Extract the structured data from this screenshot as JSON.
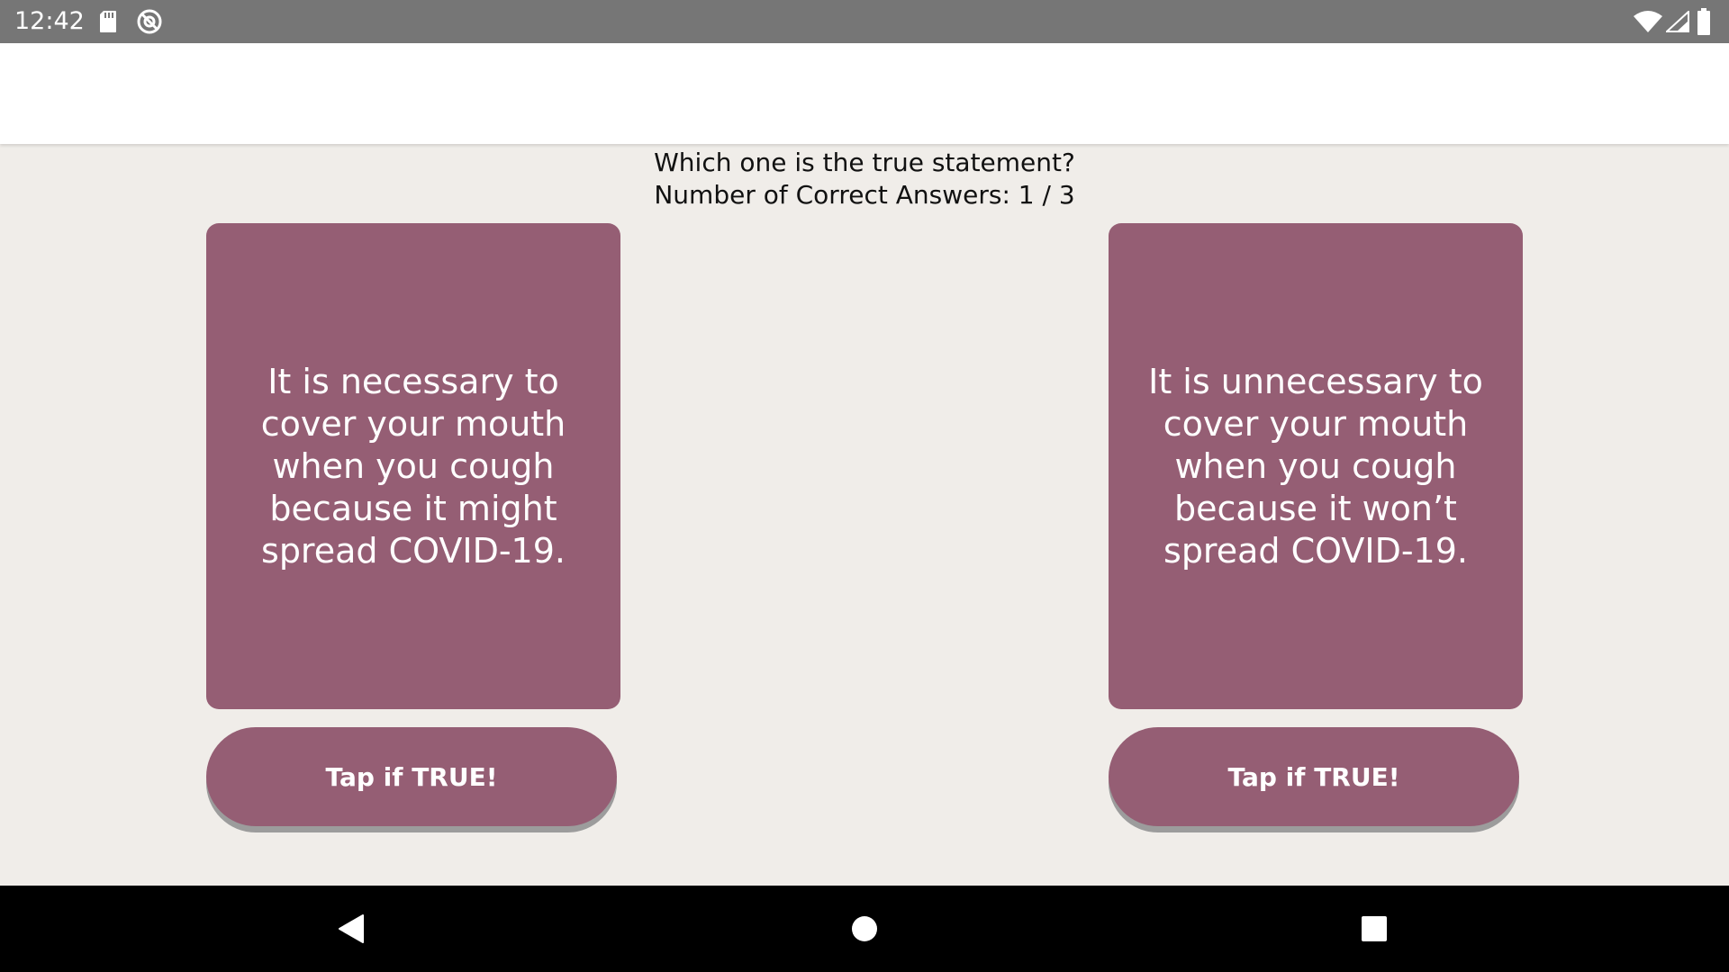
{
  "status_bar": {
    "time": "12:42",
    "icons": [
      "sd-card-icon",
      "sync-icon",
      "wifi-icon",
      "cell-signal-icon",
      "battery-icon"
    ]
  },
  "quiz": {
    "question": "Which one is the true statement?",
    "score_text": "Number of Correct Answers: 1 / 3",
    "options": [
      {
        "statement": "It is necessary to cover your mouth when you cough because it might spread COVID-19.",
        "button_label": "Tap if TRUE!"
      },
      {
        "statement": "It is unnecessary to cover your mouth when you cough because it won’t spread COVID-19.",
        "button_label": "Tap if TRUE!"
      }
    ]
  },
  "nav_bar": {
    "icons": [
      "back-icon",
      "home-icon",
      "recents-icon"
    ]
  },
  "colors": {
    "accent": "#955e74",
    "background": "#f0ede9",
    "status_bar": "#767676",
    "nav_bar": "#000000",
    "app_bar": "#ffffff"
  }
}
